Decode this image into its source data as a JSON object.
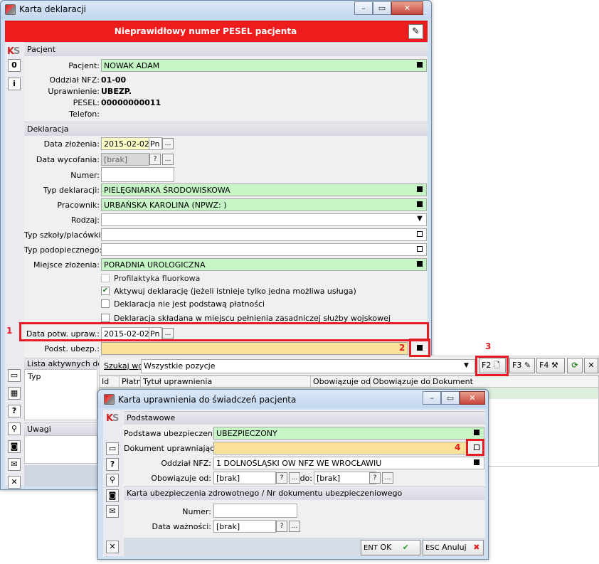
{
  "main": {
    "title": "Karta deklaracji",
    "error_banner": "Nieprawidłowy numer PESEL pacjenta",
    "pacjent": {
      "section": "Pacjent",
      "pacjent_label": "Pacjent:",
      "pacjent_value": "NOWAK ADAM",
      "oddzial_label": "Oddział NFZ:",
      "oddzial_value": "01-00",
      "uprawnienie_label": "Uprawnienie:",
      "uprawnienie_value": "UBEZP.",
      "pesel_label": "PESEL:",
      "pesel_value": "00000000011",
      "telefon_label": "Telefon:"
    },
    "deklaracja": {
      "section": "Deklaracja",
      "data_zlozenia_label": "Data złożenia:",
      "data_zlozenia_value": "2015-02-02",
      "data_zlozenia_day": "Pn",
      "data_wycofania_label": "Data wycofania:",
      "data_wycofania_value": "[brak]",
      "numer_label": "Numer:",
      "typ_label": "Typ deklaracji:",
      "typ_value": "PIELĘGNIARKA ŚRODOWISKOWA",
      "pracownik_label": "Pracownik:",
      "pracownik_value": "URBAŃSKA KAROLINA (NPWZ: )",
      "rodzaj_label": "Rodzaj:",
      "typ_szkoly_label": "Typ szkoły/placówki:",
      "typ_podopiecznego_label": "Typ podopiecznego:",
      "miejsce_label": "Miejsce złożenia:",
      "miejsce_value": "PORADNIA UROLOGICZNA",
      "chk1": "Profilaktyka fluorkowa",
      "chk2": "Aktywuj deklarację (jeżeli istnieje tylko jedna możliwa usługa)",
      "chk3": "Deklaracja nie jest podstawą płatności",
      "chk4": "Deklaracja składana w miejscu pełnienia zasadniczej służby wojskowej",
      "data_potw_label": "Data potw. upraw.:",
      "data_potw_value": "2015-02-02",
      "data_potw_day": "Pn",
      "podst_label": "Podst. ubezp.:"
    },
    "lista": {
      "label": "Lista aktywnych dekl",
      "typ_col": "Typ",
      "szukaj_label": "Szukaj wg:",
      "szukaj_value": "Wszystkie pozycje",
      "f2": "F2",
      "f3": "F3",
      "f4": "F4",
      "cols": [
        "Id",
        "Płatn",
        "Tytuł uprawnienia",
        "Obowiązuje od",
        "Obowiązuje do",
        "Dokument"
      ]
    },
    "uwagi_label": "Uwagi",
    "sidebar_badge": "0"
  },
  "dialog": {
    "title": "Karta uprawnienia do świadczeń pacjenta",
    "section1": "Podstawowe",
    "podstawa_label": "Podstawa ubezpieczenia:",
    "podstawa_value": "UBEZPIECZONY",
    "dokument_label": "Dokument uprawniający:",
    "oddzial_label": "Oddział NFZ:",
    "oddzial_value": "1 DOLNOŚLĄSKI OW NFZ WE WROCŁAWIU",
    "obowiazuje_od_label": "Obowiązuje od:",
    "od_value": "[brak]",
    "do_label": "do:",
    "do_value": "[brak]",
    "section2": "Karta ubezpieczenia zdrowotnego / Nr dokumentu ubezpieczeniowego",
    "numer_label": "Numer:",
    "data_waznosci_label": "Data ważności:",
    "data_waznosci_value": "[brak]",
    "ent_label": "ENT",
    "ok_label": "OK",
    "esc_label": "ESC",
    "anuluj_label": "Anuluj"
  },
  "annotations": {
    "n1": "1",
    "n2": "2",
    "n3": "3",
    "n4": "4",
    "color": "#e51c23"
  },
  "colors": {
    "error_banner": "#ee1c1c",
    "green_field": "#c6f5c6",
    "yellow_field": "#fbe29a"
  }
}
